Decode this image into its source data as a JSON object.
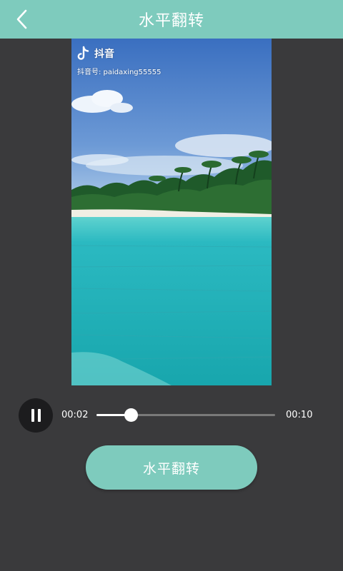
{
  "header": {
    "title": "水平翻转",
    "back_icon": "chevron-left-icon"
  },
  "video": {
    "watermark_brand": "抖音",
    "watermark_id": "抖音号: paidaxing55555",
    "brand_icon": "tiktok-logo-icon"
  },
  "player": {
    "current_time": "00:02",
    "duration": "00:10",
    "progress": 0.19,
    "state_icon": "pause-icon"
  },
  "action": {
    "label": "水平翻转"
  },
  "colors": {
    "accent": "#7ecbbd",
    "background": "#3a3a3c"
  }
}
